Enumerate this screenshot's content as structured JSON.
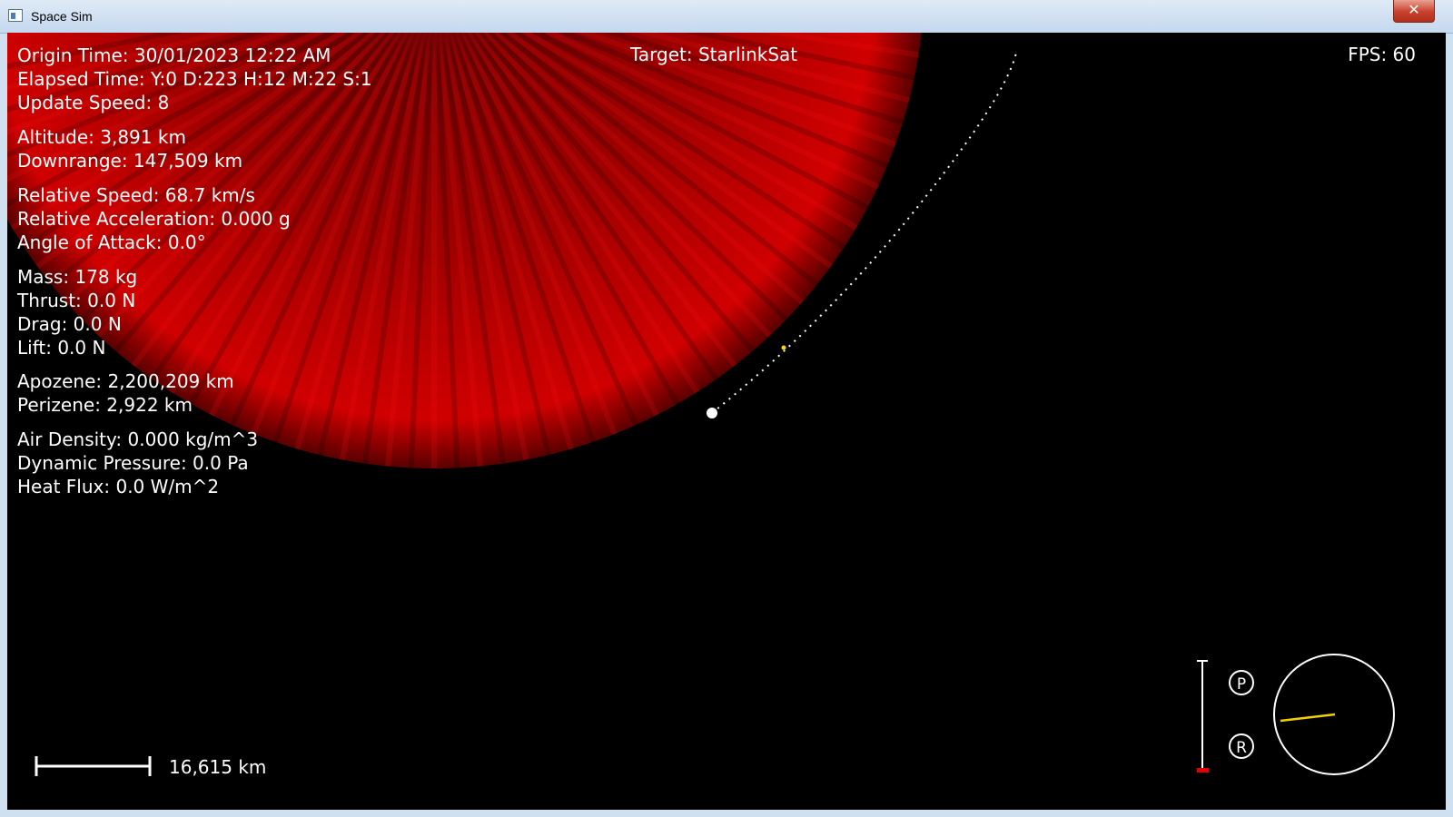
{
  "window": {
    "title": "Space Sim",
    "close_glyph": "✕",
    "icon": "window-app-icon"
  },
  "hud": {
    "time": [
      "Origin Time: 30/01/2023 12:22 AM",
      "Elapsed Time: Y:0 D:223 H:12 M:22 S:1",
      "Update Speed: 8"
    ],
    "position": [
      "Altitude: 3,891 km",
      "Downrange: 147,509 km"
    ],
    "motion": [
      "Relative Speed: 68.7 km/s",
      "Relative Acceleration: 0.000 g",
      "Angle of Attack: 0.0°"
    ],
    "forces": [
      "Mass: 178 kg",
      "Thrust: 0.0 N",
      "Drag: 0.0 N",
      "Lift: 0.0 N"
    ],
    "orbit": [
      "Apozene: 2,200,209 km",
      "Perizene: 2,922 km"
    ],
    "atmosphere": [
      "Air Density: 0.000 kg/m^3",
      "Dynamic Pressure: 0.0 Pa",
      "Heat Flux: 0.0 W/m^2"
    ]
  },
  "target": "Target: StarlinkSat",
  "fps": "FPS: 60",
  "scale_bar": {
    "label": "16,615 km"
  },
  "instruments": {
    "prograde_letter": "P",
    "retrograde_letter": "R",
    "throttle_fraction": 0.0
  },
  "colors": {
    "planet": "#c00000",
    "trajectory": "#ffffff",
    "target_marker": "#ffd800",
    "heading_line": "#f0d000",
    "throttle": "#e00000"
  }
}
